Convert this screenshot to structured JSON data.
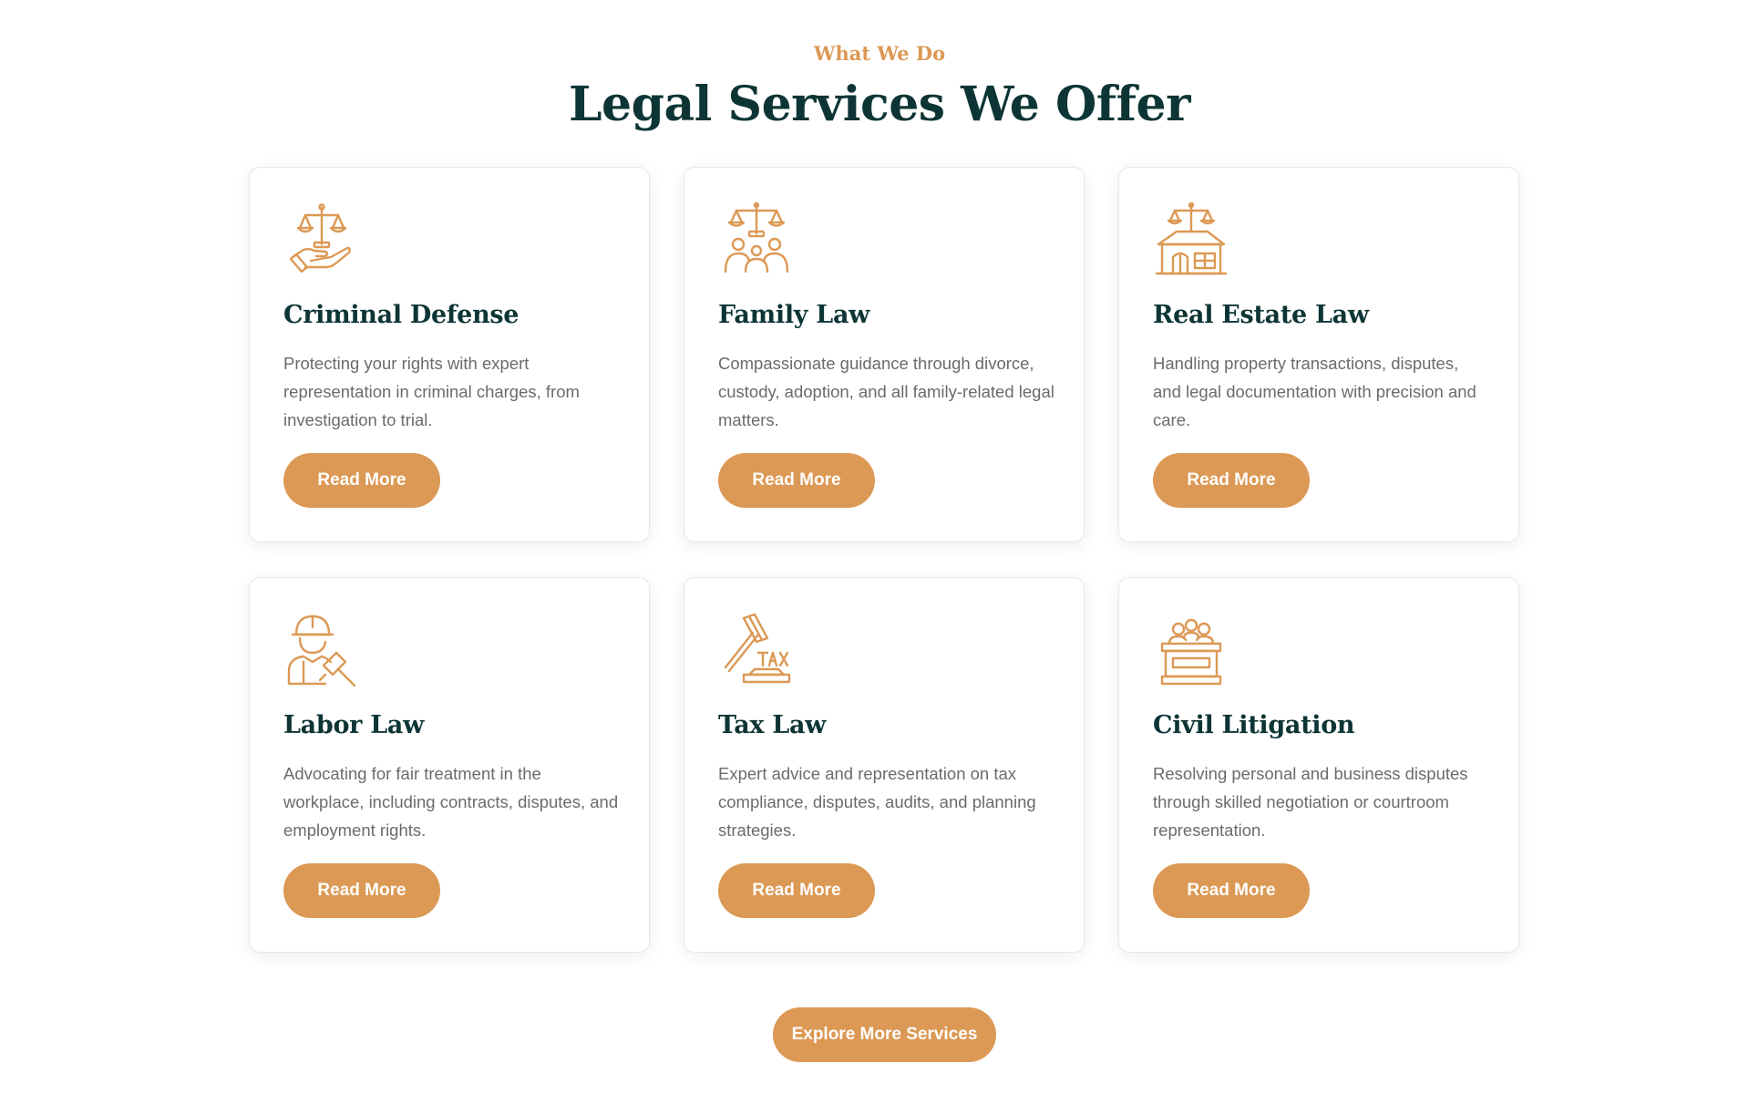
{
  "header": {
    "eyebrow": "What We Do",
    "title": "Legal Services We Offer"
  },
  "colors": {
    "accent": "#dc9955",
    "heading": "#0e3535",
    "body_text": "#6b6b6b",
    "card_border": "#e7e7e7"
  },
  "services": [
    {
      "icon": "scales-hand-icon",
      "title": "Criminal Defense",
      "text": "Protecting your rights with expert representation in criminal charges, from investigation to trial.",
      "button": "Read More"
    },
    {
      "icon": "scales-family-icon",
      "title": "Family Law",
      "text": "Compassionate guidance through divorce, custody, adoption, and all family-related legal matters.",
      "button": "Read More"
    },
    {
      "icon": "scales-house-icon",
      "title": "Real Estate Law",
      "text": "Handling property transactions, disputes, and legal documentation with precision and care.",
      "button": "Read More"
    },
    {
      "icon": "worker-gavel-icon",
      "title": "Labor Law",
      "text": "Advocating for fair treatment in the workplace, including contracts, disputes, and employment rights.",
      "button": "Read More"
    },
    {
      "icon": "tax-gavel-icon",
      "title": "Tax Law",
      "text": "Expert advice and representation on tax compliance, disputes, audits, and planning strategies.",
      "button": "Read More"
    },
    {
      "icon": "courtroom-icon",
      "title": "Civil Litigation",
      "text": "Resolving personal and business disputes through skilled negotiation or courtroom representation.",
      "button": "Read More"
    }
  ],
  "cta": {
    "label": "Explore More Services"
  }
}
